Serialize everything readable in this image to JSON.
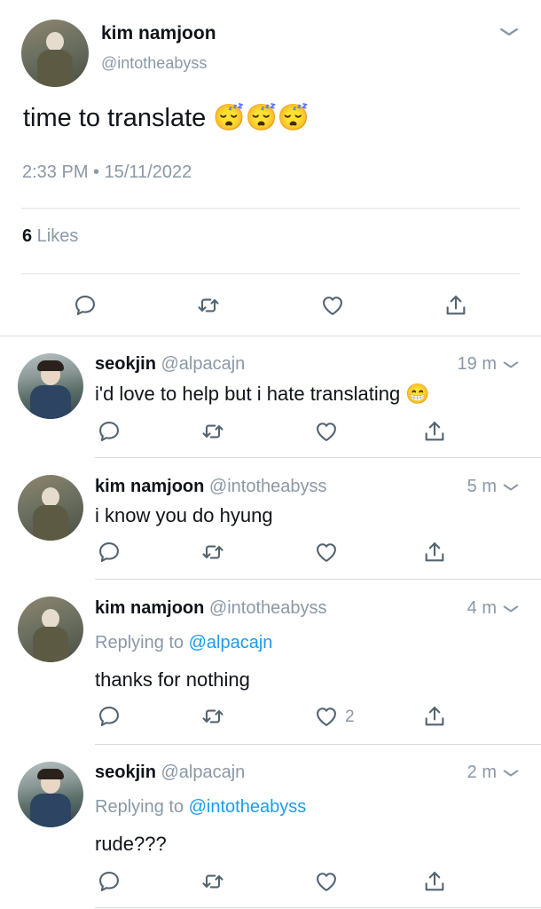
{
  "main_tweet": {
    "display_name": "kim namjoon",
    "handle": "@intotheabyss",
    "text": "time to translate",
    "emoji": "😴😴😴",
    "timestamp": "2:33 PM • 15/11/2022",
    "likes_count": "6",
    "likes_label": " Likes"
  },
  "replies": [
    {
      "display_name": "seokjin",
      "handle": "@alpacajn",
      "time": "19 m",
      "replying_prefix": "",
      "replying_to": "",
      "text": "i'd love to help but i hate translating",
      "emoji": "😁",
      "like_count": ""
    },
    {
      "display_name": "kim namjoon",
      "handle": "@intotheabyss",
      "time": "5 m",
      "replying_prefix": "",
      "replying_to": "",
      "text": "i know you do hyung",
      "emoji": "",
      "like_count": ""
    },
    {
      "display_name": "kim namjoon",
      "handle": "@intotheabyss",
      "time": "4 m",
      "replying_prefix": "Replying to ",
      "replying_to": "@alpacajn",
      "text": "thanks for nothing",
      "emoji": "",
      "like_count": "2"
    },
    {
      "display_name": "seokjin",
      "handle": "@alpacajn",
      "time": "2 m",
      "replying_prefix": "Replying to ",
      "replying_to": "@intotheabyss",
      "text": "rude???",
      "emoji": "",
      "like_count": ""
    }
  ],
  "icons": {
    "reply": "reply-icon",
    "retweet": "retweet-icon",
    "like": "heart-icon",
    "share": "share-icon",
    "more": "chevron-down-icon"
  },
  "colors": {
    "link": "#1d9bf0",
    "secondary_text": "#8b98a5",
    "icon": "#536471"
  }
}
